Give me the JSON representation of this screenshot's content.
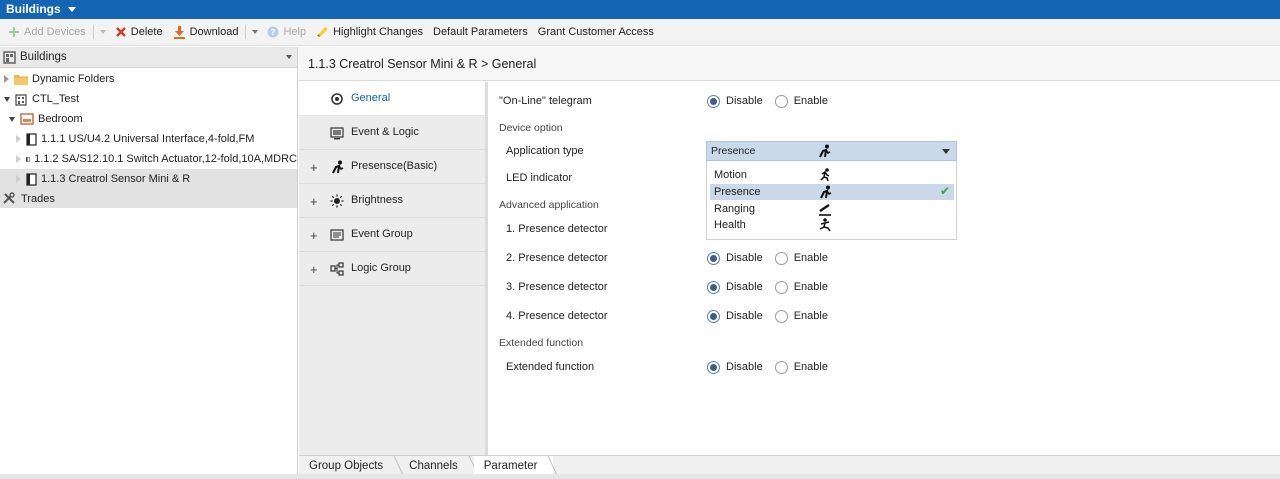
{
  "app": {
    "title": "Buildings"
  },
  "toolbar": {
    "add_devices": "Add Devices",
    "delete": "Delete",
    "download": "Download",
    "help": "Help",
    "highlight_changes": "Highlight Changes",
    "default_parameters": "Default Parameters",
    "grant_customer_access": "Grant Customer Access"
  },
  "left_panel": {
    "header": "Buildings",
    "tree": [
      {
        "label": "Dynamic Folders",
        "icon": "folder-icon"
      },
      {
        "label": "CTL_Test",
        "icon": "building-icon"
      },
      {
        "label": "Bedroom",
        "icon": "room-icon"
      },
      {
        "label": "1.1.1 US/U4.2 Universal Interface,4-fold,FM",
        "icon": "device-icon"
      },
      {
        "label": "1.1.2 SA/S12.10.1 Switch Actuator,12-fold,10A,MDRC",
        "icon": "device-icon"
      },
      {
        "label": "1.1.3 Creatrol Sensor Mini & R",
        "icon": "device-icon"
      }
    ],
    "trades": "Trades"
  },
  "content": {
    "breadcrumb": "1.1.3 Creatrol Sensor Mini & R > General"
  },
  "nav": [
    {
      "label": "General",
      "icon": "gear-icon"
    },
    {
      "label": "Event & Logic",
      "icon": "monitor-icon"
    },
    {
      "label": "Presensce(Basic)",
      "icon": "person-icon"
    },
    {
      "label": "Brightness",
      "icon": "sun-icon"
    },
    {
      "label": "Event Group",
      "icon": "list-icon"
    },
    {
      "label": "Logic Group",
      "icon": "logic-icon"
    }
  ],
  "params": {
    "online_telegram": "\"On-Line\" telegram",
    "device_option": "Device option",
    "application_type": "Application type",
    "led_indicator": "LED indicator",
    "advanced_application": "Advanced application",
    "presence_detector_1": "1. Presence detector",
    "presence_detector_2": "2. Presence detector",
    "presence_detector_3": "3. Presence detector",
    "presence_detector_4": "4. Presence detector",
    "extended_function_section": "Extended function",
    "extended_function": "Extended function",
    "disable": "Disable",
    "enable": "Enable"
  },
  "dropdown": {
    "selected": "Presence",
    "options": [
      "Motion",
      "Presence",
      "Ranging",
      "Health"
    ]
  },
  "bottom_tabs": [
    "Group Objects",
    "Channels",
    "Parameter"
  ],
  "colors": {
    "accent": "#1464b4",
    "selection": "#c9d9ea",
    "check": "#3d9a3d"
  }
}
